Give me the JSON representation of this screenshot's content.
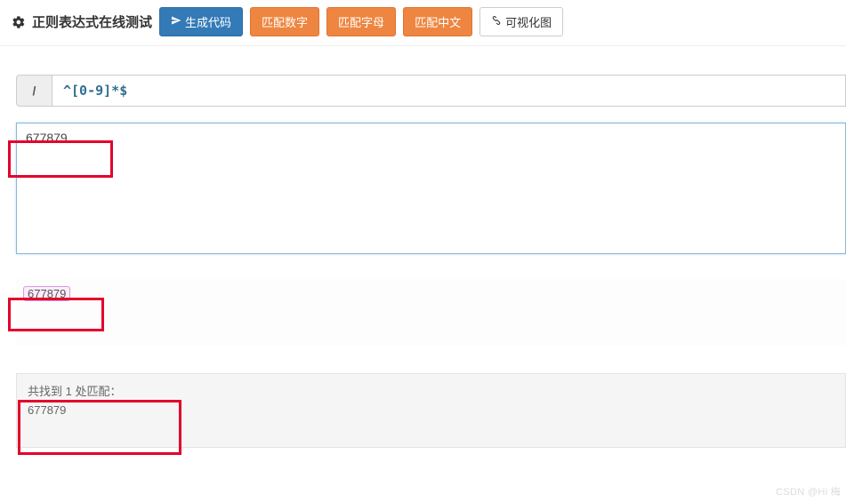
{
  "header": {
    "title": "正则表达式在线测试",
    "buttons": {
      "generate": "生成代码",
      "match_digit": "匹配数字",
      "match_alpha": "匹配字母",
      "match_cn": "匹配中文",
      "visualize": "可视化图"
    }
  },
  "regex": {
    "slash": "/",
    "pattern": "^[0-9]*$"
  },
  "test_input": "677879",
  "result": {
    "highlight": "677879"
  },
  "summary": {
    "line1": "共找到 1 处匹配：",
    "line2": "677879"
  },
  "watermark": "CSDN @Hi 梅"
}
